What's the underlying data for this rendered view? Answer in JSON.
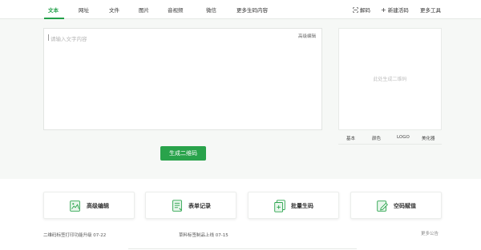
{
  "nav": {
    "tabs": [
      {
        "label": "文本",
        "active": true
      },
      {
        "label": "网址",
        "active": false
      },
      {
        "label": "文件",
        "active": false
      },
      {
        "label": "图片",
        "active": false
      },
      {
        "label": "音视频",
        "active": false
      },
      {
        "label": "微信",
        "active": false
      },
      {
        "label": "更多生码内容",
        "active": false
      }
    ],
    "decode_label": "解码",
    "new_live_code_label": "新建活码",
    "more_tools_label": "更多工具"
  },
  "editor": {
    "placeholder": "请输入文字内容",
    "advanced_edit_label": "高级编辑"
  },
  "generate_button": "生成二维码",
  "qr_panel": {
    "hint": "此处生成二维码",
    "tabs": [
      "基本",
      "颜色",
      "LOGO",
      "美化器"
    ]
  },
  "feature_cards": [
    {
      "label": "高级编辑",
      "icon": "image-edit-icon"
    },
    {
      "label": "表单记录",
      "icon": "form-record-icon"
    },
    {
      "label": "批量生码",
      "icon": "batch-generate-icon"
    },
    {
      "label": "空码赋值",
      "icon": "empty-code-assign-icon"
    }
  ],
  "news": [
    {
      "text": "二维码标签打印功能升级   07-22"
    },
    {
      "text": "草料标签制品上线   07-15"
    }
  ],
  "more_announcements": "更多公告",
  "colors": {
    "accent": "#23a04a",
    "button": "#29a34b",
    "background": "#f6f8f6"
  }
}
